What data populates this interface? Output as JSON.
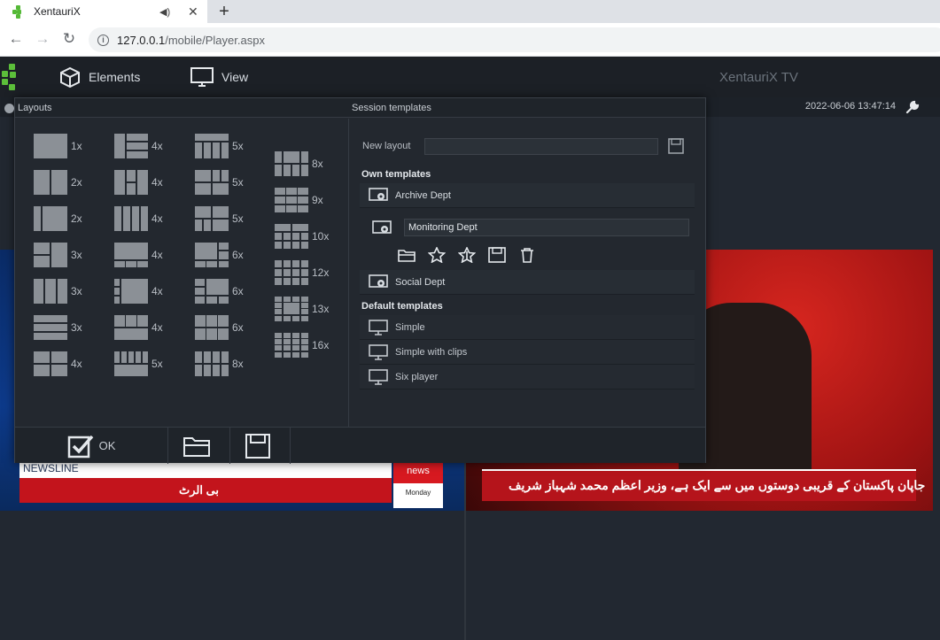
{
  "browser": {
    "tab_title": "XentauriX",
    "new_tab_icon": "+",
    "url_host": "127.0.0.1",
    "url_path": "/mobile/Player.aspx"
  },
  "header": {
    "elements_label": "Elements",
    "view_label": "View",
    "brand": "XentauriX TV"
  },
  "status": {
    "datetime": "2022-06-06 13:47:14"
  },
  "dialog": {
    "layouts_title": "Layouts",
    "templates_title": "Session templates",
    "layouts": [
      {
        "label": "1x"
      },
      {
        "label": "2x"
      },
      {
        "label": "2x"
      },
      {
        "label": "3x"
      },
      {
        "label": "3x"
      },
      {
        "label": "3x"
      },
      {
        "label": "4x"
      },
      {
        "label": "4x"
      },
      {
        "label": "4x"
      },
      {
        "label": "4x"
      },
      {
        "label": "4x"
      },
      {
        "label": "4x"
      },
      {
        "label": "4x"
      },
      {
        "label": "5x"
      },
      {
        "label": "5x"
      },
      {
        "label": "5x"
      },
      {
        "label": "5x"
      },
      {
        "label": "6x"
      },
      {
        "label": "6x"
      },
      {
        "label": "6x"
      },
      {
        "label": "8x"
      },
      {
        "label": "8x"
      },
      {
        "label": "9x"
      },
      {
        "label": "10x"
      },
      {
        "label": "12x"
      },
      {
        "label": "13x"
      },
      {
        "label": "16x"
      }
    ],
    "new_layout_label": "New layout",
    "new_layout_value": "",
    "own_title": "Own templates",
    "own": [
      {
        "label": "Archive Dept"
      },
      {
        "label": "Monitoring Dept"
      },
      {
        "label": "Social Dept"
      }
    ],
    "default_title": "Default templates",
    "defaults": [
      {
        "label": "Simple"
      },
      {
        "label": "Simple with clips"
      },
      {
        "label": "Six player"
      }
    ],
    "ok_label": "OK"
  },
  "feeds": {
    "left_ticker": "NEWSLINE",
    "left_channel": "news",
    "left_day": "Monday",
    "left_urdu": "بی الرٹ",
    "right_urdu": "جاپان پاکستان کے قریبی دوستوں میں سے ایک ہے، وزیر اعظم محمد شہباز شریف"
  },
  "colors": {
    "accent_green": "#5cbf3a",
    "panel_bg": "#23282f",
    "ticker_red": "#c3141c"
  }
}
